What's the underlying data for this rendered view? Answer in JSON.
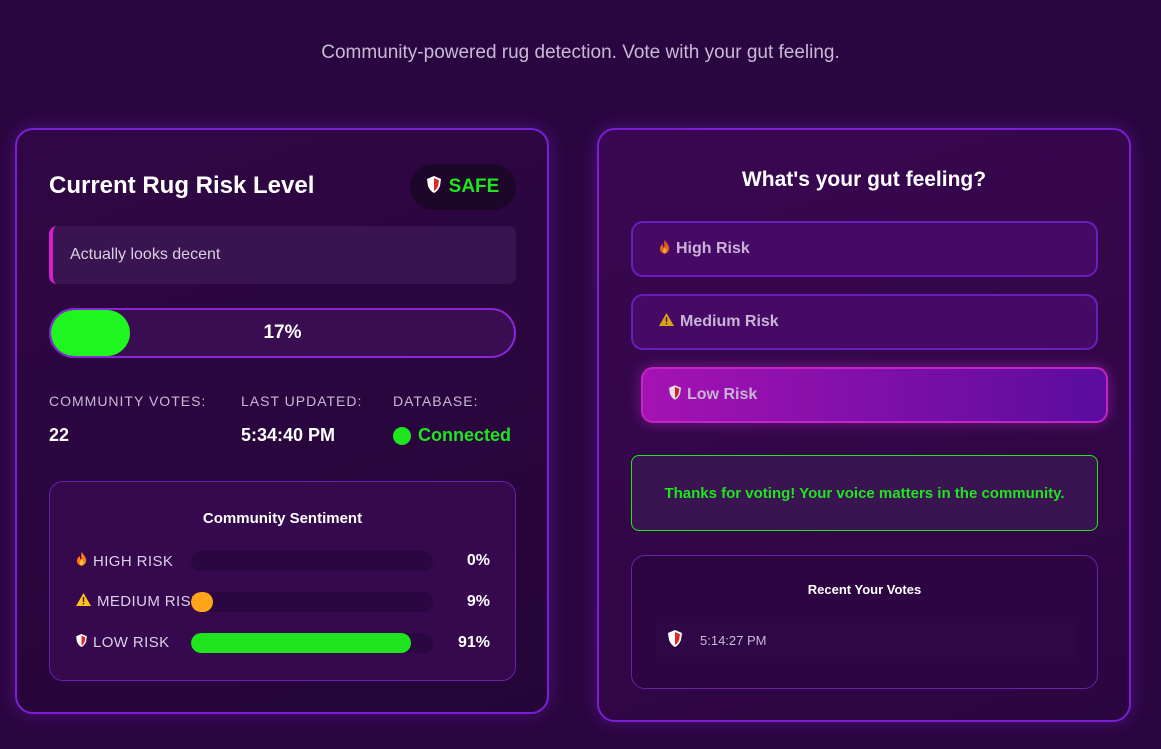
{
  "header": {
    "tagline": "Community-powered rug detection. Vote with your gut feeling."
  },
  "risk_panel": {
    "title": "Current Rug Risk Level",
    "badge": {
      "label": "SAFE",
      "icon": "shield-icon",
      "color": "#1ee51e"
    },
    "message": "Actually looks decent",
    "meter": {
      "percent_label": "17%",
      "value": 0.17,
      "fill_color": "#1ff51f"
    },
    "stats": {
      "votes_label": "COMMUNITY VOTES:",
      "votes_value": "22",
      "updated_label": "LAST UPDATED:",
      "updated_value": "5:34:40 PM",
      "db_label": "DATABASE:",
      "db_value": "Connected"
    },
    "sentiment": {
      "title": "Community Sentiment",
      "rows": [
        {
          "icon": "fire-icon",
          "label": "HIGH RISK",
          "pct": "0%",
          "value": 0.0,
          "color": "#e5281e"
        },
        {
          "icon": "warning-icon",
          "label": "MEDIUM RISK",
          "pct": "9%",
          "value": 0.09,
          "color": "#ffa51a"
        },
        {
          "icon": "shield-icon",
          "label": "LOW RISK",
          "pct": "91%",
          "value": 0.91,
          "color": "#1ee51e"
        }
      ]
    }
  },
  "vote_panel": {
    "title": "What's your gut feeling?",
    "options": [
      {
        "label": "High Risk",
        "icon": "fire-icon",
        "selected": false
      },
      {
        "label": "Medium Risk",
        "icon": "warning-icon",
        "selected": false
      },
      {
        "label": "Low Risk",
        "icon": "shield-icon",
        "selected": true
      }
    ],
    "thanks": "Thanks for voting! Your voice matters in the community.",
    "recent": {
      "title": "Recent Your Votes",
      "items": [
        {
          "icon": "shield-icon",
          "time": "5:14:27 PM"
        }
      ]
    }
  },
  "colors": {
    "accent": "#7b1fd6",
    "success": "#1ee51e",
    "background": "#2a0640"
  }
}
